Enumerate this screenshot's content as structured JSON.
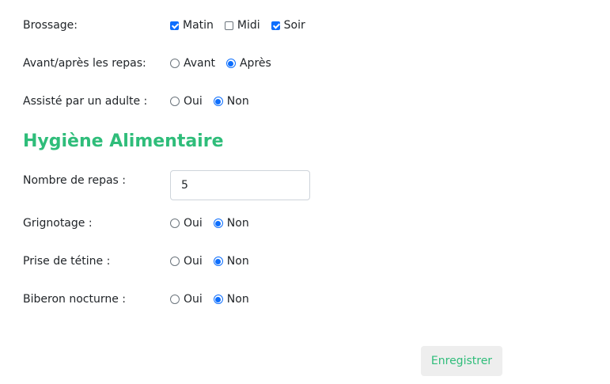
{
  "brossage": {
    "label": "Brossage:",
    "options": [
      {
        "label": "Matin",
        "checked": true
      },
      {
        "label": "Midi",
        "checked": false
      },
      {
        "label": "Soir",
        "checked": true
      }
    ]
  },
  "repas_timing": {
    "label": "Avant/après les repas:",
    "options": [
      {
        "label": "Avant",
        "checked": false
      },
      {
        "label": "Après",
        "checked": true
      }
    ]
  },
  "assiste": {
    "label": "Assisté par un adulte :",
    "options": [
      {
        "label": "Oui",
        "checked": false
      },
      {
        "label": "Non",
        "checked": true
      }
    ]
  },
  "section_title": "Hygiène Alimentaire",
  "nombre_repas": {
    "label": "Nombre de repas :",
    "value": "5"
  },
  "grignotage": {
    "label": "Grignotage :",
    "options": [
      {
        "label": "Oui",
        "checked": false
      },
      {
        "label": "Non",
        "checked": true
      }
    ]
  },
  "tetine": {
    "label": "Prise de tétine :",
    "options": [
      {
        "label": "Oui",
        "checked": false
      },
      {
        "label": "Non",
        "checked": true
      }
    ]
  },
  "biberon": {
    "label": "Biberon nocturne :",
    "options": [
      {
        "label": "Oui",
        "checked": false
      },
      {
        "label": "Non",
        "checked": true
      }
    ]
  },
  "save_label": "Enregistrer",
  "colors": {
    "accent_green": "#2fbd7a",
    "control_blue": "#0d6efd",
    "button_bg": "#eeeeee"
  }
}
